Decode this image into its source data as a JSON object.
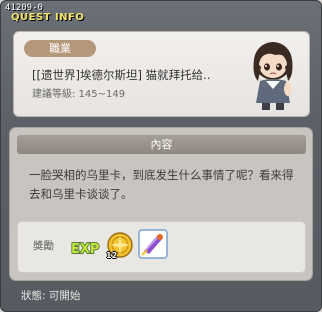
{
  "window": {
    "quest_id": "41209-0",
    "title": "QUEST INFO"
  },
  "quest": {
    "job_label": "職業",
    "name": "[[遗世界]埃德尔斯坦] 猫就拜托给..",
    "level": "建議等級: 145~149"
  },
  "content": {
    "header": "內容",
    "text": "一脸哭相的乌里卡，到底发生什么事情了呢？看来得去和乌里卡谈谈了。"
  },
  "rewards": {
    "label": "獎勵",
    "exp_text": "EXP",
    "coin_count": "12",
    "icons": [
      "exp-icon",
      "gold-coin-icon",
      "scroll-item-icon"
    ]
  },
  "status": {
    "text": "狀態:  可開始"
  },
  "colors": {
    "frame": "#5c6067",
    "title_yellow": "#f3e36a",
    "job_tag": "#b5977a",
    "content_header": "#9a938c"
  }
}
